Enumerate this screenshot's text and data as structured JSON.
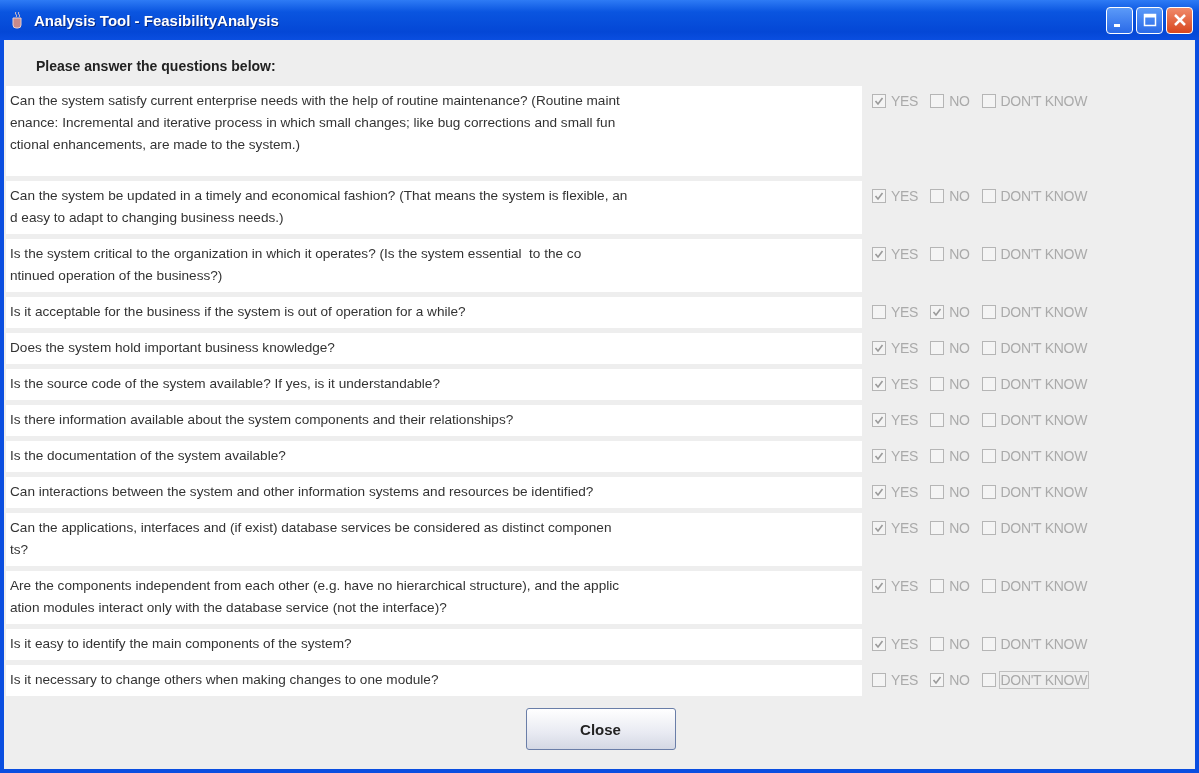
{
  "window": {
    "title": "Analysis Tool - FeasibilityAnalysis"
  },
  "instruction": "Please answer the questions below:",
  "questions": [
    {
      "lines": [
        "Can the system satisfy current enterprise needs with the help of routine maintenance? (Routine maint",
        "enance: Incremental and iterative process in which small changes; like bug corrections and small fun",
        "ctional enhancements, are made to the system.)"
      ],
      "options": [
        {
          "label": "YES",
          "checked": true,
          "focused": false
        },
        {
          "label": "NO",
          "checked": false,
          "focused": false
        },
        {
          "label": "DON'T KNOW",
          "checked": false,
          "focused": false
        }
      ]
    },
    {
      "lines": [
        "Can the system be updated in a timely and economical fashion? (That means the system is flexible, an",
        "d easy to adapt to changing business needs.)"
      ],
      "options": [
        {
          "label": "YES",
          "checked": true,
          "focused": false
        },
        {
          "label": "NO",
          "checked": false,
          "focused": false
        },
        {
          "label": "DON'T KNOW",
          "checked": false,
          "focused": false
        }
      ]
    },
    {
      "lines": [
        "Is the system critical to the organization in which it operates? (Is the system essential  to the co",
        "ntinued operation of the business?)"
      ],
      "options": [
        {
          "label": "YES",
          "checked": true,
          "focused": false
        },
        {
          "label": "NO",
          "checked": false,
          "focused": false
        },
        {
          "label": "DON'T KNOW",
          "checked": false,
          "focused": false
        }
      ]
    },
    {
      "lines": [
        "Is it acceptable for the business if the system is out of operation for a while?"
      ],
      "options": [
        {
          "label": "YES",
          "checked": false,
          "focused": false
        },
        {
          "label": "NO",
          "checked": true,
          "focused": false
        },
        {
          "label": "DON'T KNOW",
          "checked": false,
          "focused": false
        }
      ]
    },
    {
      "lines": [
        "Does the system hold important business knowledge?"
      ],
      "options": [
        {
          "label": "YES",
          "checked": true,
          "focused": false
        },
        {
          "label": "NO",
          "checked": false,
          "focused": false
        },
        {
          "label": "DON'T KNOW",
          "checked": false,
          "focused": false
        }
      ]
    },
    {
      "lines": [
        "Is the source code of the system available? If yes, is it understandable?"
      ],
      "options": [
        {
          "label": "YES",
          "checked": true,
          "focused": false
        },
        {
          "label": "NO",
          "checked": false,
          "focused": false
        },
        {
          "label": "DON'T KNOW",
          "checked": false,
          "focused": false
        }
      ]
    },
    {
      "lines": [
        "Is there information available about the system components and their relationships?"
      ],
      "options": [
        {
          "label": "YES",
          "checked": true,
          "focused": false
        },
        {
          "label": "NO",
          "checked": false,
          "focused": false
        },
        {
          "label": "DON'T KNOW",
          "checked": false,
          "focused": false
        }
      ]
    },
    {
      "lines": [
        "Is the documentation of the system available?"
      ],
      "options": [
        {
          "label": "YES",
          "checked": true,
          "focused": false
        },
        {
          "label": "NO",
          "checked": false,
          "focused": false
        },
        {
          "label": "DON'T KNOW",
          "checked": false,
          "focused": false
        }
      ]
    },
    {
      "lines": [
        "Can interactions between the system and other information systems and resources be identified?"
      ],
      "options": [
        {
          "label": "YES",
          "checked": true,
          "focused": false
        },
        {
          "label": "NO",
          "checked": false,
          "focused": false
        },
        {
          "label": "DON'T KNOW",
          "checked": false,
          "focused": false
        }
      ]
    },
    {
      "lines": [
        "Can the applications, interfaces and (if exist) database services be considered as distinct componen",
        "ts?"
      ],
      "options": [
        {
          "label": "YES",
          "checked": true,
          "focused": false
        },
        {
          "label": "NO",
          "checked": false,
          "focused": false
        },
        {
          "label": "DON'T KNOW",
          "checked": false,
          "focused": false
        }
      ]
    },
    {
      "lines": [
        "Are the components independent from each other (e.g. have no hierarchical structure), and the applic",
        "ation modules interact only with the database service (not the interface)?"
      ],
      "options": [
        {
          "label": "YES",
          "checked": true,
          "focused": false
        },
        {
          "label": "NO",
          "checked": false,
          "focused": false
        },
        {
          "label": "DON'T KNOW",
          "checked": false,
          "focused": false
        }
      ]
    },
    {
      "lines": [
        "Is it easy to identify the main components of the system?"
      ],
      "options": [
        {
          "label": "YES",
          "checked": true,
          "focused": false
        },
        {
          "label": "NO",
          "checked": false,
          "focused": false
        },
        {
          "label": "DON'T KNOW",
          "checked": false,
          "focused": false
        }
      ]
    },
    {
      "lines": [
        "Is it necessary to change others when making changes to one module?"
      ],
      "options": [
        {
          "label": "YES",
          "checked": false,
          "focused": false
        },
        {
          "label": "NO",
          "checked": true,
          "focused": false
        },
        {
          "label": "DON'T KNOW",
          "checked": false,
          "focused": true
        }
      ]
    }
  ],
  "close_button": "Close"
}
